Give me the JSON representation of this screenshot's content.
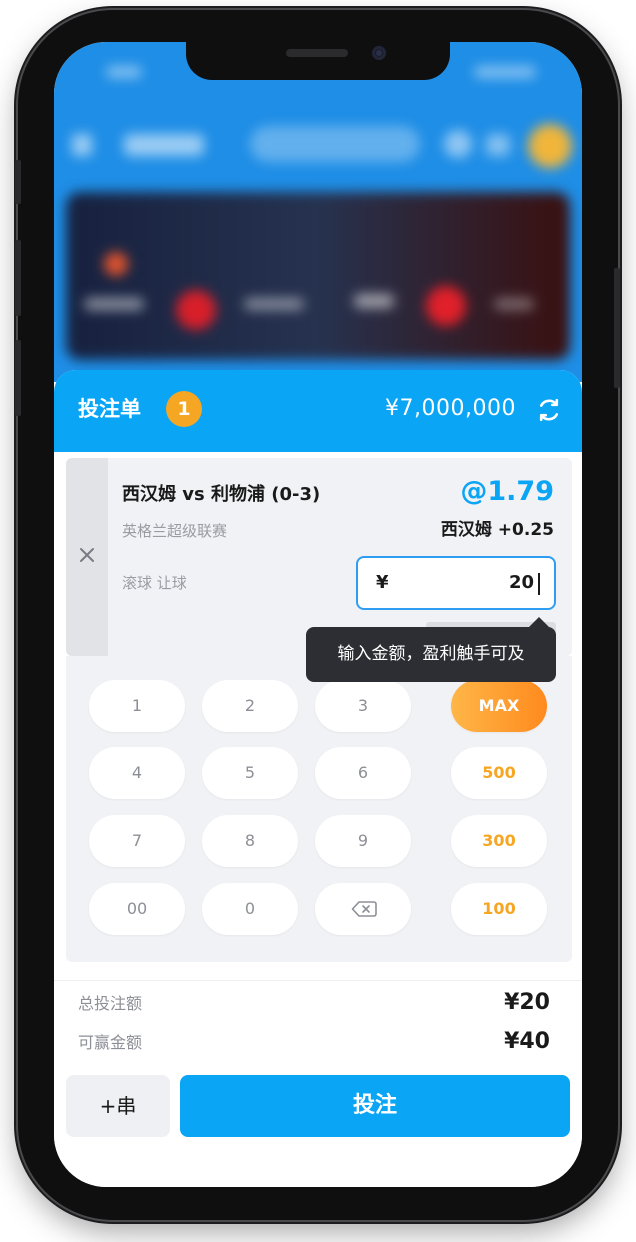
{
  "bet_slip": {
    "title": "投注单",
    "count": "1",
    "balance": "¥7,000,000"
  },
  "bet": {
    "match": "西汉姆 vs 利物浦 (0-3)",
    "odds": "@1.79",
    "league": "英格兰超级联赛",
    "selection": "西汉姆 +0.25",
    "market": "滚球 让球",
    "stake_currency": "¥",
    "stake_value": "20"
  },
  "tooltip": "输入金额，盈利触手可及",
  "keypad": {
    "rows": [
      [
        "1",
        "2",
        "3",
        "MAX"
      ],
      [
        "4",
        "5",
        "6",
        "500"
      ],
      [
        "7",
        "8",
        "9",
        "300"
      ],
      [
        "00",
        "0",
        "backspace",
        "100"
      ]
    ]
  },
  "summary": {
    "total_label": "总投注额",
    "total_value": "¥20",
    "win_label": "可赢金额",
    "win_value": "¥40"
  },
  "buttons": {
    "parlay": "+串",
    "place": "投注"
  },
  "colors": {
    "primary": "#0aa5f5",
    "accent": "#f5a623",
    "tooltip_bg": "#2d2e33"
  },
  "icons": {
    "close": "close-icon",
    "refresh": "refresh-icon",
    "backspace": "backspace-icon"
  }
}
